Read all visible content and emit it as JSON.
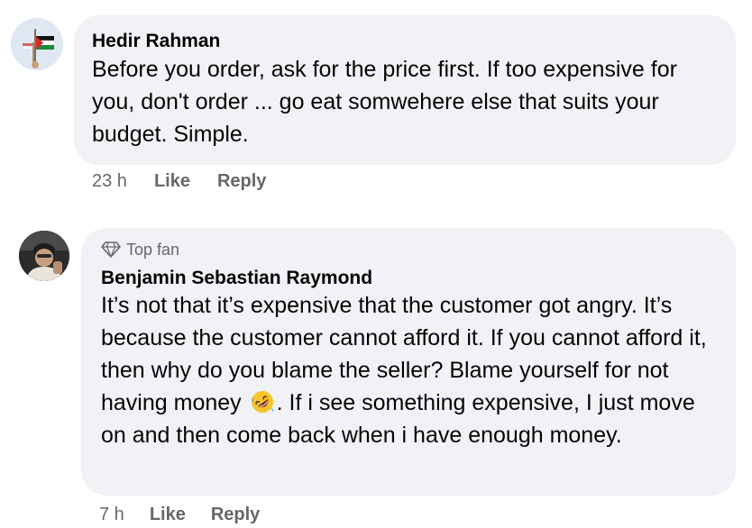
{
  "comments": [
    {
      "author": "Hedir Rahman",
      "text": "Before you order, ask for the price first. If too expensive for you, don't order ... go eat somwehere else that suits your budget. Simple.",
      "time": "23 h",
      "like_label": "Like",
      "reply_label": "Reply",
      "avatar_icon": "palestine-flag-icon"
    },
    {
      "badge": "Top fan",
      "badge_icon": "diamond-icon",
      "author": "Benjamin Sebastian Raymond",
      "text_before_emoji": "It’s not that it’s expensive that the customer got angry. It’s because the customer cannot afford it. If you cannot afford it, then why do you blame the seller? Blame yourself for not having money ",
      "emoji": "rolling-on-floor-laughing-emoji",
      "text_after_emoji": ". If i see something expensive, I just move on and then come back when i have enough money.",
      "time": "7 h",
      "like_label": "Like",
      "reply_label": "Reply",
      "avatar_icon": "user-photo"
    }
  ],
  "colors": {
    "bubble": "#f0f2f5",
    "text": "#050505",
    "secondary": "#65676b"
  }
}
